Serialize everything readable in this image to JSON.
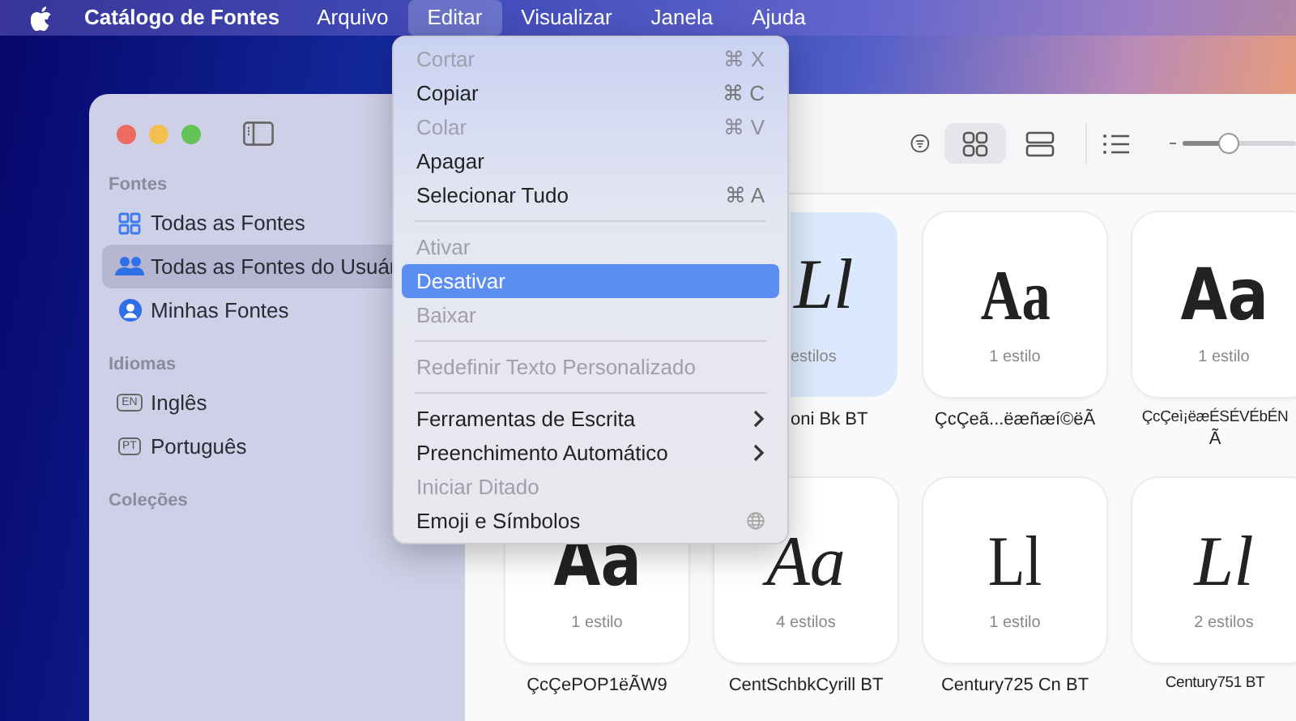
{
  "menu_bar": {
    "app_name": "Catálogo de Fontes",
    "menus": [
      {
        "label": "Arquivo",
        "selected": false
      },
      {
        "label": "Editar",
        "selected": true
      },
      {
        "label": "Visualizar",
        "selected": false
      },
      {
        "label": "Janela",
        "selected": false
      },
      {
        "label": "Ajuda",
        "selected": false
      }
    ]
  },
  "edit_menu": [
    {
      "kind": "item",
      "label": "Cortar",
      "shortcut": "⌘ X",
      "disabled": true,
      "selected": false
    },
    {
      "kind": "item",
      "label": "Copiar",
      "shortcut": "⌘ C",
      "disabled": false,
      "selected": false
    },
    {
      "kind": "item",
      "label": "Colar",
      "shortcut": "⌘ V",
      "disabled": true,
      "selected": false
    },
    {
      "kind": "item",
      "label": "Apagar",
      "disabled": false,
      "selected": false
    },
    {
      "kind": "item",
      "label": "Selecionar Tudo",
      "shortcut": "⌘ A",
      "disabled": false,
      "selected": false
    },
    {
      "kind": "separator"
    },
    {
      "kind": "item",
      "label": "Ativar",
      "disabled": true,
      "selected": false
    },
    {
      "kind": "item",
      "label": "Desativar",
      "disabled": false,
      "selected": true
    },
    {
      "kind": "item",
      "label": "Baixar",
      "disabled": true,
      "selected": false
    },
    {
      "kind": "separator"
    },
    {
      "kind": "item",
      "label": "Redefinir Texto Personalizado",
      "disabled": true,
      "selected": false
    },
    {
      "kind": "separator"
    },
    {
      "kind": "submenu",
      "label": "Ferramentas de Escrita",
      "disabled": false,
      "selected": false
    },
    {
      "kind": "submenu",
      "label": "Preenchimento Automático",
      "disabled": false,
      "selected": false
    },
    {
      "kind": "item",
      "label": "Iniciar Ditado",
      "disabled": true,
      "selected": false
    },
    {
      "kind": "globe",
      "label": "Emoji e Símbolos",
      "disabled": false,
      "selected": false
    }
  ],
  "sidebar": {
    "sections": [
      {
        "title": "Fontes",
        "items": [
          {
            "kind": "grid",
            "label": "Todas as Fontes",
            "selected": false
          },
          {
            "kind": "people",
            "label": "Todas as Fontes do Usuár",
            "selected": true
          },
          {
            "kind": "person",
            "label": "Minhas Fontes",
            "selected": false
          }
        ]
      },
      {
        "title": "Idiomas",
        "items": [
          {
            "kind": "badge",
            "badge": "EN",
            "label": "Inglês",
            "selected": false
          },
          {
            "kind": "badge",
            "badge": "PT",
            "label": "Português",
            "selected": false
          }
        ]
      },
      {
        "title": "Coleções"
      }
    ]
  },
  "toolbar": {
    "views": [
      {
        "kind": "grid",
        "selected": true
      },
      {
        "kind": "rows",
        "selected": false
      },
      {
        "kind": "list",
        "selected": false
      }
    ],
    "size_slider": {
      "level": 0.4
    }
  },
  "grid": [
    [
      {
        "kind": "serif-italic",
        "partial": true,
        "glyph": "Ll",
        "styles": "estilos",
        "name": "oni Bk BT",
        "selected": true
      },
      {
        "kind": "serif-bold",
        "partial": false,
        "glyph": "Aa",
        "styles": "1 estilo",
        "name": "ÇcÇeã...ëæñæí©ëÃ",
        "selected": false
      },
      {
        "kind": "sans-black",
        "partial": false,
        "glyph": "Aa",
        "styles": "1 estilo",
        "name": "ÇcÇeì¡ëæÉSÉVÉbÉN",
        "name_cont": "Ã",
        "selected": false
      }
    ],
    [
      {
        "kind": "sans-black",
        "partial": false,
        "glyph": "Aa",
        "styles": "1 estilo",
        "name": "ÇcÇePOP1ëÃW9",
        "selected": false
      },
      {
        "kind": "serif-italic",
        "partial": false,
        "glyph": "Aa",
        "styles": "4 estilos",
        "name": "CentSchbkCyrill BT",
        "selected": false
      },
      {
        "kind": "serif",
        "partial": false,
        "glyph": "Ll",
        "styles": "1 estilo",
        "name": "Century725 Cn BT",
        "selected": false
      },
      {
        "kind": "serif-italic",
        "partial": false,
        "glyph": "Ll",
        "styles": "2 estilos",
        "name": "Century751 BT",
        "selected": false
      }
    ]
  ]
}
